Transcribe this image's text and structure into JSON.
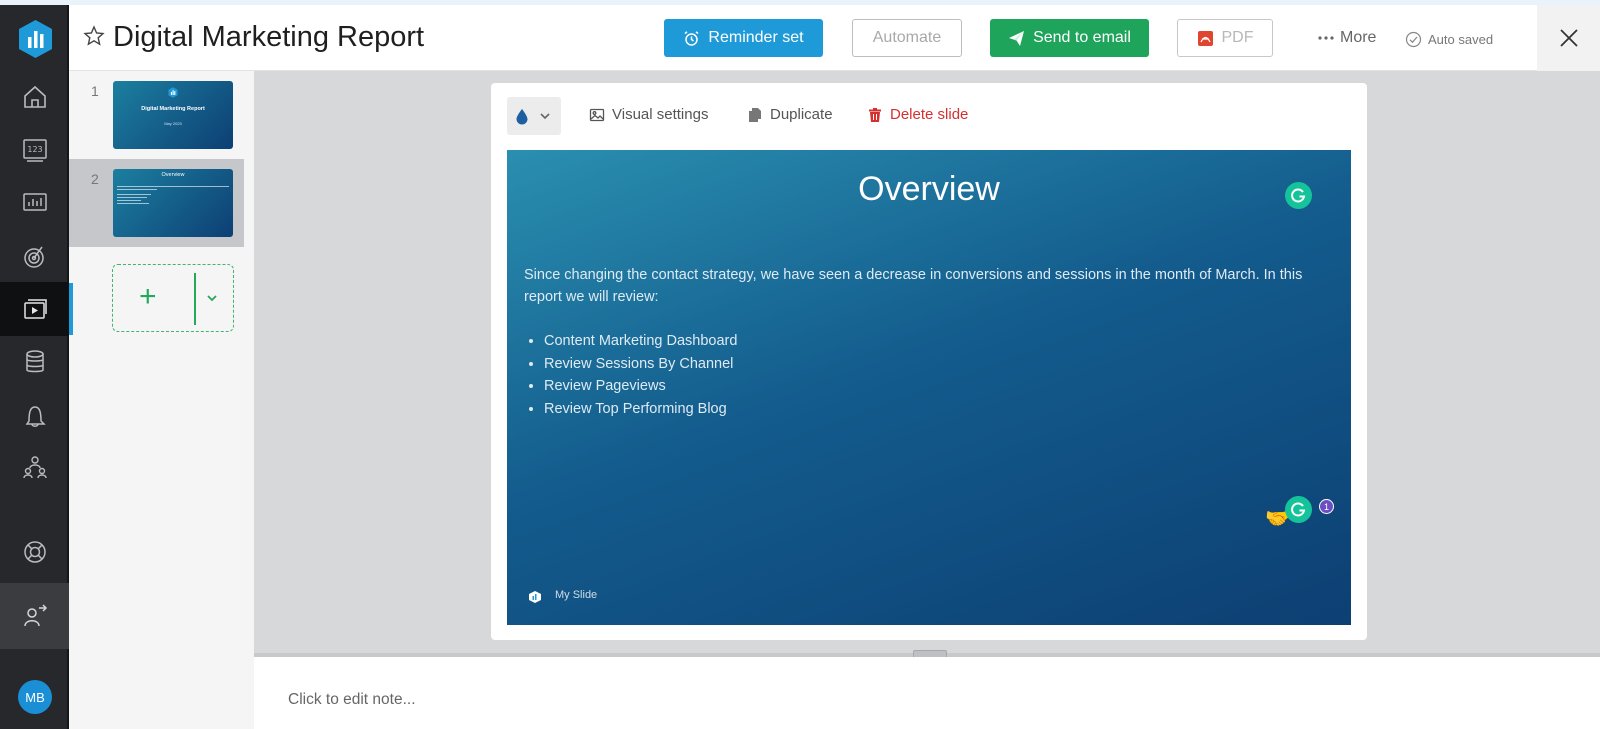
{
  "header": {
    "title": "Digital Marketing Report",
    "reminder_label": "Reminder set",
    "automate_label": "Automate",
    "email_label": "Send to email",
    "pdf_label": "PDF",
    "more_label": "More",
    "autosaved_label": "Auto saved"
  },
  "sidebar": {
    "avatar_initials": "MB",
    "icons": [
      "home-icon",
      "metrics-icon",
      "dashboard-icon",
      "goals-icon",
      "slides-icon",
      "datasets-icon",
      "alerts-icon",
      "team-icon",
      "help-icon",
      "profile-icon"
    ]
  },
  "slides": {
    "items": [
      {
        "number": "1",
        "thumb_title": "Digital Marketing Report",
        "thumb_sub": "May 2023"
      },
      {
        "number": "2",
        "thumb_title": "Overview"
      }
    ]
  },
  "toolbar": {
    "visual_label": "Visual settings",
    "duplicate_label": "Duplicate",
    "delete_label": "Delete slide"
  },
  "slide": {
    "title": "Overview",
    "body": "Since changing the contact strategy, we have seen a decrease in conversions and sessions in the month of March. In this report we will review:",
    "bullets": [
      "Content Marketing Dashboard",
      "Review Sessions By Channel",
      "Review Pageviews",
      "Review Top Performing Blog"
    ],
    "footer": "My Slide",
    "badge_count": "1"
  },
  "notes": {
    "placeholder": "Click to edit note..."
  },
  "colors": {
    "primary_blue": "#1f9ad8",
    "email_green": "#1fa45b",
    "delete_red": "#d62f2f",
    "slide_top": "#2a8fb0",
    "slide_bottom": "#0d3f73",
    "grammarly_green": "#15c39a"
  }
}
